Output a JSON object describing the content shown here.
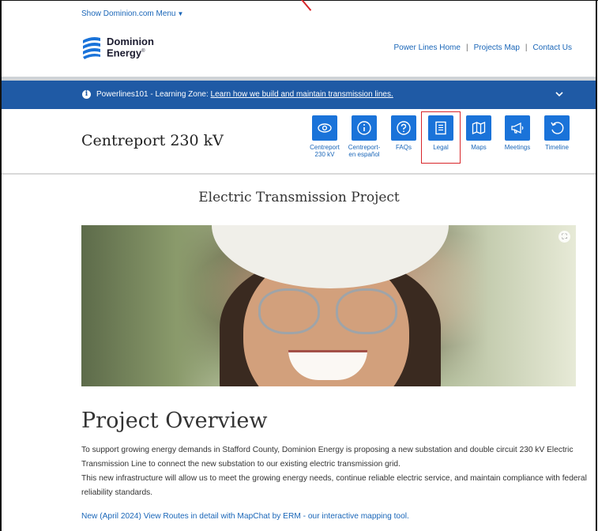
{
  "header": {
    "show_menu": "Show Dominion.com Menu",
    "logo_line1": "Dominion",
    "logo_line2": "Energy",
    "links": [
      "Power Lines Home",
      "Projects Map",
      "Contact Us"
    ]
  },
  "banner": {
    "prefix": "Powerlines101 - Learning Zone: ",
    "link": "Learn how we build and maintain transmission lines."
  },
  "project": {
    "title": "Centreport 230 kV",
    "nav": [
      {
        "icon": "eye-icon",
        "label": "Centreport 230 kV"
      },
      {
        "icon": "info-icon",
        "label": "Centreport- en español"
      },
      {
        "icon": "question-icon",
        "label": "FAQs"
      },
      {
        "icon": "document-icon",
        "label": "Legal"
      },
      {
        "icon": "map-icon",
        "label": "Maps"
      },
      {
        "icon": "megaphone-icon",
        "label": "Meetings"
      },
      {
        "icon": "history-icon",
        "label": "Timeline"
      }
    ]
  },
  "main": {
    "heading": "Electric Transmission Project",
    "overview_title": "Project Overview",
    "paragraph1": "To support growing energy demands in Stafford County, Dominion Energy is proposing a new substation and double circuit 230 kV Electric Transmission Line to connect the new substation to our existing electric transmission grid.",
    "paragraph2": "This new infrastructure will allow us to meet the growing energy needs, continue reliable electric service, and maintain compliance with federal reliability standards.",
    "mapchat_link": "New (April 2024) View Routes in detail with MapChat by ERM - our interactive mapping tool."
  },
  "colors": {
    "brand_blue": "#1f5aa5",
    "button_blue": "#1a73d9",
    "link_blue": "#1a66b8",
    "highlight_red": "#d8262a"
  }
}
